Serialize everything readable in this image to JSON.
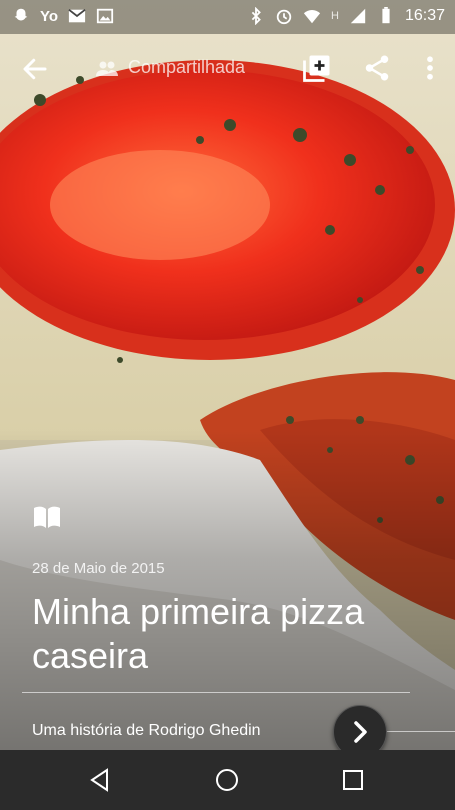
{
  "status_bar": {
    "carrier_label": "Yo",
    "time": "16:37",
    "network_letter": "H"
  },
  "app_bar": {
    "shared_label": "Compartilhada"
  },
  "story": {
    "date": "28 de Maio de 2015",
    "title": "Minha primeira pizza caseira",
    "author_line": "Uma história de Rodrigo Ghedin"
  }
}
